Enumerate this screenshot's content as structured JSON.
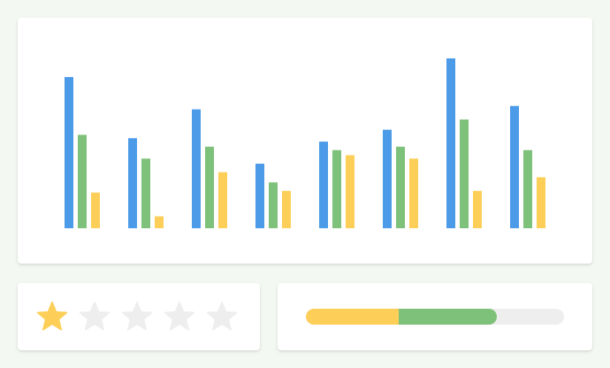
{
  "chart_data": {
    "type": "bar",
    "categories": [
      "",
      "",
      "",
      "",
      "",
      "",
      "",
      ""
    ],
    "ylim": [
      0,
      100
    ],
    "grid": false,
    "series": [
      {
        "color": "#4c9be8",
        "values": [
          89,
          53,
          70,
          38,
          51,
          58,
          100,
          72
        ]
      },
      {
        "color": "#7ec17a",
        "values": [
          55,
          41,
          48,
          27,
          46,
          48,
          64,
          46
        ]
      },
      {
        "color": "#fdcf58",
        "values": [
          21,
          7,
          33,
          22,
          43,
          41,
          22,
          30
        ]
      }
    ]
  },
  "rating": {
    "value": 1,
    "max": 5,
    "filled_color": "#fdcf58",
    "empty_color": "#eeeeee",
    "icon": "star-icon"
  },
  "progress": {
    "primary_fraction": 0.36,
    "secondary_fraction": 0.74,
    "primary_color": "#fdcf58",
    "secondary_color": "#7ec17a",
    "track_color": "#eeeeee"
  }
}
